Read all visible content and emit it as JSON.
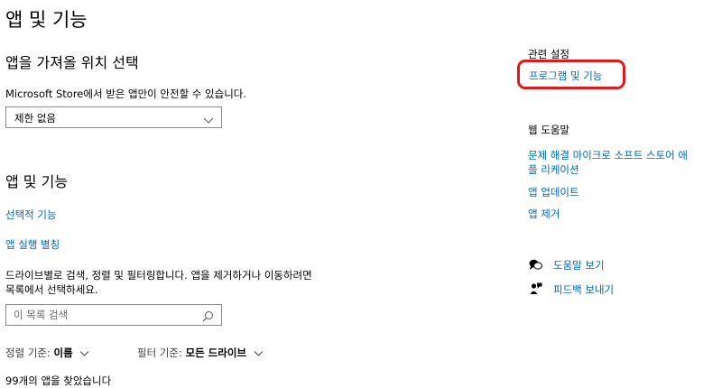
{
  "page_title": "앱 및 기능",
  "install_section": {
    "heading": "앱을 가져올 위치 선택",
    "description": "Microsoft Store에서 받은 앱만이 안전할 수 있습니다.",
    "dropdown_value": "제한 없음"
  },
  "apps_section": {
    "heading": "앱 및 기능",
    "optional_features_link": "선택적 기능",
    "app_aliases_link": "앱 실행 별칭",
    "description_line1": "드라이브별로 검색, 정렬 및 필터링합니다. 앱을 제거하거나 이동하려면",
    "description_line2": "목록에서 선택하세요.",
    "search_placeholder": "이 목록 검색",
    "sort_label": "정렬 기준:",
    "sort_value": "이름",
    "filter_label": "필터 기준:",
    "filter_value": "모든 드라이브",
    "found_count": "99개의 앱을 찾았습니다"
  },
  "related_settings": {
    "heading": "관련 설정",
    "programs_link": "프로그램 및 기능"
  },
  "web_help": {
    "heading": "웹 도움말",
    "link1_line1": "문제 해결 마이크로 소프트 스토어 애",
    "link1_line2": "플 리케이션",
    "link2": "앱 업데이트",
    "link3": "앱 제거"
  },
  "support": {
    "get_help": "도움말 보기",
    "feedback": "피드백 보내기"
  },
  "colors": {
    "link": "#0067c0",
    "highlight": "#e0191b"
  }
}
